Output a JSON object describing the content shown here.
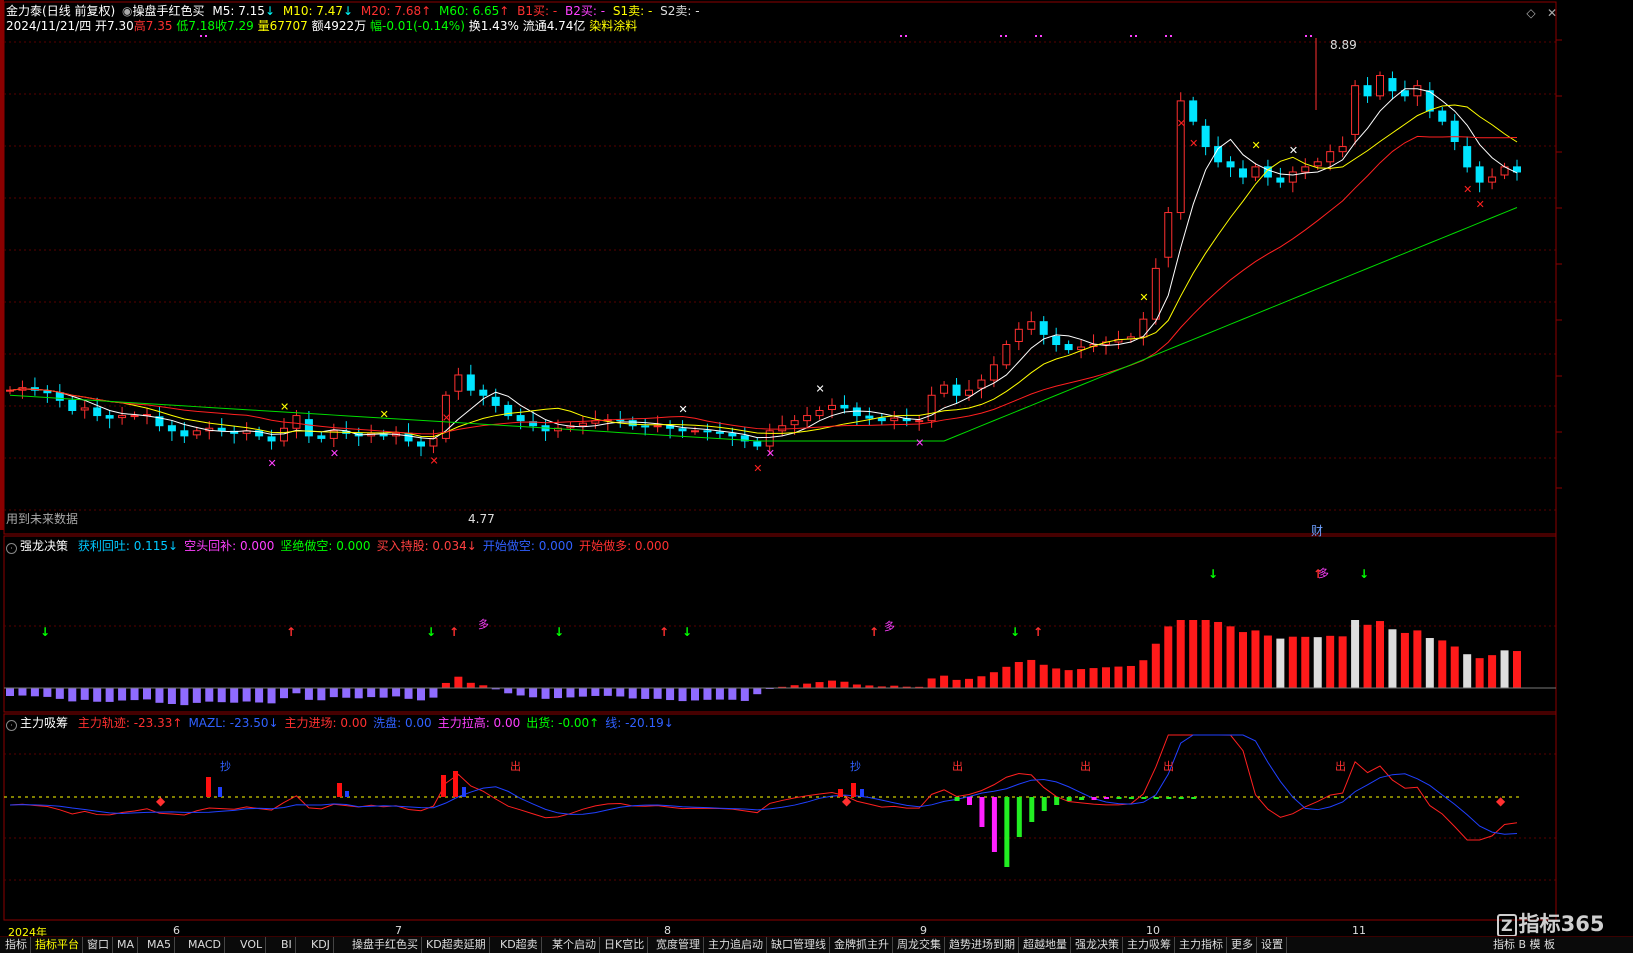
{
  "header": {
    "stock_name": "金力泰",
    "period": "(日线 前复权)",
    "indicator_name": "操盘手红色买",
    "ma5": "M5: 7.15",
    "ma10": "M10: 7.47",
    "ma20": "M20: 7.68",
    "ma60": "M60: 6.65",
    "b1": "B1买: -",
    "b2": "B2买: -",
    "s1": "S1卖: -",
    "s2": "S2卖: -",
    "date": "2024/11/21/四",
    "open": "开7.30",
    "high": "高7.35",
    "low": "低7.18",
    "close": "收7.29",
    "volume": "量67707",
    "amount": "额4922万",
    "change": "幅-0.01(-0.14%)",
    "turnover": "换1.43%",
    "float_cap": "流通4.74亿",
    "concept": "染料涂料"
  },
  "main_chart": {
    "price_high_label": "8.89",
    "price_low_label": "4.77",
    "future_data_note": "用到未来数据",
    "finance_marker": "财"
  },
  "panel1": {
    "name": "强龙决策",
    "vals": [
      {
        "label": "获利回吐: 0.115↓",
        "color": "#00c8ff"
      },
      {
        "label": "空头回补: 0.000",
        "color": "#ff40ff"
      },
      {
        "label": "坚绝做空: 0.000",
        "color": "#00ff00"
      },
      {
        "label": "买入持股: 0.034↓",
        "color": "#ff4040"
      },
      {
        "label": "开始做空: 0.000",
        "color": "#3060ff"
      },
      {
        "label": "开始做多: 0.000",
        "color": "#ff3030"
      }
    ],
    "duo_label": "多"
  },
  "panel2": {
    "name": "主力吸筹",
    "vals": [
      {
        "label": "主力轨迹: -23.33↑",
        "color": "#ff3030"
      },
      {
        "label": "MAZL: -23.50↓",
        "color": "#3060ff"
      },
      {
        "label": "主力进场: 0.00",
        "color": "#ff3030"
      },
      {
        "label": "洗盘: 0.00",
        "color": "#3060ff"
      },
      {
        "label": "主力拉高: 0.00",
        "color": "#ff40ff"
      },
      {
        "label": "出货: -0.00↑",
        "color": "#00ff00"
      },
      {
        "label": "线: -20.19↓",
        "color": "#3060ff"
      }
    ],
    "chao_label": "抄",
    "chu_label": "出"
  },
  "x_axis": {
    "year_label": "2024年",
    "months": [
      "6",
      "7",
      "8",
      "9",
      "10",
      "11"
    ]
  },
  "tabs": [
    "指标",
    "指标平台",
    "窗口",
    "MA",
    "MA5",
    "MACD",
    "VOL",
    "BI",
    "KDJ",
    "操盘手红色买",
    "KD超卖延期",
    "KD超卖",
    "某个启动",
    "日K宫比",
    "宽度管理",
    "主力追启动",
    "缺口管理线",
    "金牌抓主升",
    "周龙交集",
    "趋势进场到期",
    "超越地量",
    "强龙决策",
    "主力吸筹",
    "主力指标",
    "更多",
    "设置"
  ],
  "active_tab": "指标平台",
  "logo_text": "指标365",
  "bottom_right_label": "指标 B 模 板"
}
